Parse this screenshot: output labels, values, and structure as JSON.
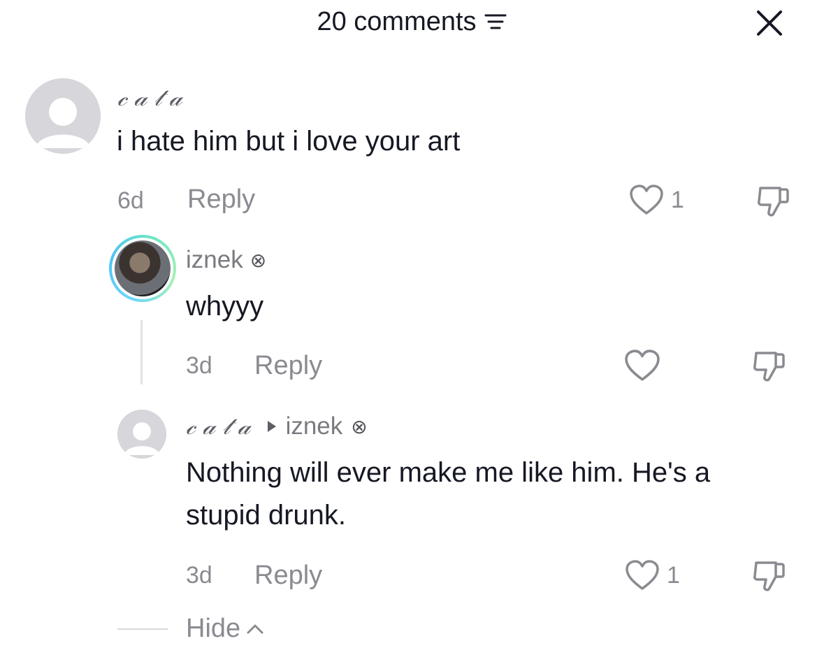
{
  "header": {
    "comments_count_label": "20 comments",
    "sort_icon": "sort-lines-icon",
    "close_icon": "close-icon"
  },
  "comments": [
    {
      "author": "𝒸𝒶𝓉𝒶",
      "text": "i hate him but i love your art",
      "time": "6d",
      "reply_label": "Reply",
      "likes": "1"
    },
    {
      "author": "iznek",
      "author_badge": "⊗",
      "text": "whyyy",
      "time": "3d",
      "reply_label": "Reply",
      "likes": ""
    },
    {
      "author": "𝒸𝒶𝓉𝒶",
      "reply_to": "iznek",
      "reply_to_badge": "⊗",
      "text_line1": "Nothing will ever make me like him. He's a",
      "text_line2": "stupid drunk.",
      "time": "3d",
      "reply_label": "Reply",
      "likes": "1"
    }
  ],
  "footer": {
    "hide_label": "Hide"
  },
  "colors": {
    "text": "#161823",
    "muted": "#8a8b91",
    "ring_accent": "#4cc3f5"
  }
}
